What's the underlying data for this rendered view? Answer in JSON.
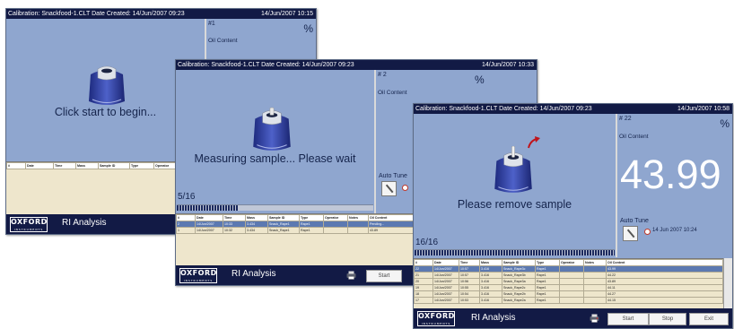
{
  "screens": [
    {
      "title": "Calibration: Snackfood-1.CLT   Date Created: 14/Jun/2007 09:23",
      "datetime": "14/Jun/2007 10:15",
      "sample_no": "#1",
      "unit": "%",
      "parameter": "Oil Content",
      "message": "Click start to begin...",
      "table_headers": [
        "#",
        "Date",
        "Time",
        "Mass",
        "Sample ID",
        "Type",
        "Operator",
        "N"
      ],
      "app_title": "RI Analysis",
      "logo_text": "OXFORD",
      "logo_subtext": "INSTRUMENTS"
    },
    {
      "title": "Calibration: Snackfood-1.CLT   Date Created: 14/Jun/2007 09:23",
      "datetime": "14/Jun/2007 10:33",
      "sample_no": "# 2",
      "unit": "%",
      "parameter": "Oil Content",
      "message": "Measuring sample... Please wait",
      "counter": "5/16",
      "progress": 0.31,
      "auto_tune_label": "Auto Tune",
      "table_headers": [
        "#",
        "Date",
        "Time",
        "Mass",
        "Sample ID",
        "Type",
        "Operator",
        "Notes",
        "Oil Content"
      ],
      "rows": [
        [
          "2",
          "14/Jun/2007",
          "10:33",
          "3.434",
          "Snack_Rape1",
          "Rape1",
          "",
          "",
          "Pending..."
        ],
        [
          "1",
          "14/Jun/2007",
          "10:32",
          "3.434",
          "Snack_Rape1",
          "Rape1",
          "",
          "",
          "43.89"
        ]
      ],
      "app_title": "RI Analysis",
      "logo_text": "OXFORD",
      "logo_subtext": "INSTRUMENTS",
      "start_label": "Start"
    },
    {
      "title": "Calibration: Snackfood-1.CLT   Date Created: 14/Jun/2007 09:23",
      "datetime": "14/Jun/2007 10:58",
      "sample_no": "# 22",
      "unit": "%",
      "parameter": "Oil Content",
      "result": "43.99",
      "message": "Please remove sample",
      "counter": "16/16",
      "progress": 1.0,
      "auto_tune_label": "Auto Tune",
      "auto_tune_date": "14 Jun 2007 10:24",
      "table_headers": [
        "#",
        "Date",
        "Time",
        "Mass",
        "Sample ID",
        "Type",
        "Operator",
        "Notes",
        "Oil Content"
      ],
      "rows": [
        [
          "22",
          "14/Jun/2007",
          "10:57",
          "3.416",
          "Snack_Rape3c",
          "Rape1",
          "",
          "",
          "43.99"
        ],
        [
          "21",
          "14/Jun/2007",
          "10:57",
          "3.416",
          "Snack_Rape3b",
          "Rape1",
          "",
          "",
          "44.22"
        ],
        [
          "20",
          "14/Jun/2007",
          "10:56",
          "3.416",
          "Snack_Rape3a",
          "Rape1",
          "",
          "",
          "43.89"
        ],
        [
          "19",
          "14/Jun/2007",
          "10:55",
          "3.416",
          "Snack_Rape2c",
          "Rape1",
          "",
          "",
          "44.11"
        ],
        [
          "18",
          "14/Jun/2007",
          "10:54",
          "3.416",
          "Snack_Rape2b",
          "Rape1",
          "",
          "",
          "44.27"
        ],
        [
          "17",
          "14/Jun/2007",
          "10:53",
          "3.416",
          "Snack_Rape2a",
          "Rape1",
          "",
          "",
          "44.15"
        ]
      ],
      "app_title": "RI Analysis",
      "logo_text": "OXFORD",
      "logo_subtext": "INSTRUMENTS",
      "start_label": "Start",
      "stop_label": "Stop",
      "exit_label": "Exit"
    }
  ]
}
